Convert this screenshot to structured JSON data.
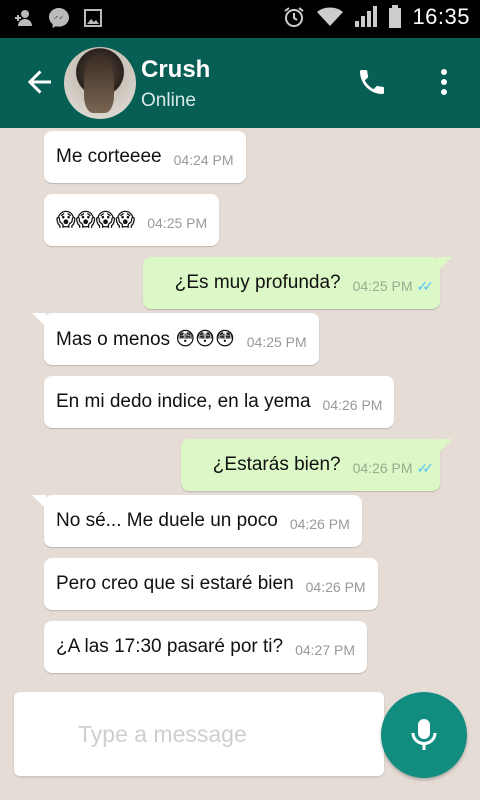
{
  "status_bar": {
    "time": "16:35",
    "icons": [
      "user-add-icon",
      "messenger-icon",
      "image-icon",
      "alarm-icon",
      "wifi-icon",
      "signal-icon",
      "battery-icon"
    ]
  },
  "header": {
    "contact_name": "Crush",
    "contact_status": "Online",
    "background_color": "#075e54"
  },
  "messages": [
    {
      "direction": "in",
      "text": "Me corteeee",
      "time": "04:24 PM"
    },
    {
      "direction": "in",
      "text": "😱😱😱😱",
      "time": "04:25 PM"
    },
    {
      "direction": "out",
      "text": "¿Es muy profunda?",
      "time": "04:25 PM",
      "status": "read"
    },
    {
      "direction": "in",
      "text": "Mas o menos 😳😳😳",
      "time": "04:25 PM"
    },
    {
      "direction": "in",
      "text": "En mi dedo indice, en la yema",
      "time": "04:26 PM"
    },
    {
      "direction": "out",
      "text": "¿Estarás bien?",
      "time": "04:26 PM",
      "status": "read"
    },
    {
      "direction": "in",
      "text": "No sé... Me duele un poco",
      "time": "04:26 PM"
    },
    {
      "direction": "in",
      "text": "Pero creo que si estaré bien",
      "time": "04:26 PM"
    },
    {
      "direction": "in",
      "text": "¿A las 17:30 pasaré por ti?",
      "time": "04:27 PM"
    }
  ],
  "composer": {
    "placeholder": "Type a message",
    "value": ""
  },
  "colors": {
    "incoming_bubble": "#ffffff",
    "outgoing_bubble": "#dcf8c6",
    "read_ticks": "#4fc3f7",
    "mic_button": "#128c7e"
  }
}
